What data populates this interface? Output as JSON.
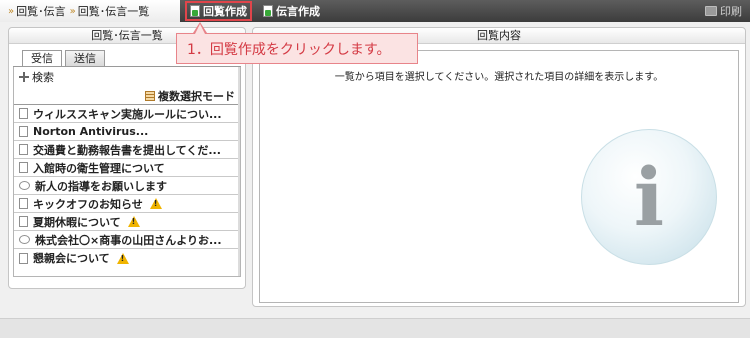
{
  "breadcrumb": {
    "item1": "回覧･伝言",
    "item2": "回覧･伝言一覧"
  },
  "toolbar": {
    "circular_create": "回覧作成",
    "message_create": "伝言作成",
    "print": "印刷"
  },
  "callout": {
    "text": "1．回覧作成をクリックします。"
  },
  "left": {
    "title": "回覧･伝言一覧",
    "tabs": [
      "受信",
      "送信"
    ],
    "search_label": "検索",
    "multi_select_label": "複数選択モード",
    "items": [
      {
        "label": "ウィルススキャン実施ルールについ...",
        "icon": "document-icon",
        "warning": false
      },
      {
        "label": "Norton Antivirus...",
        "icon": "document-icon",
        "warning": false
      },
      {
        "label": "交通費と勤務報告書を提出してくだ...",
        "icon": "document-icon",
        "warning": false
      },
      {
        "label": "入館時の衛生管理について",
        "icon": "document-icon",
        "warning": false
      },
      {
        "label": "新人の指導をお願いします",
        "icon": "speech-bubble-icon",
        "warning": false
      },
      {
        "label": "キックオフのお知らせ",
        "icon": "document-icon",
        "warning": true
      },
      {
        "label": "夏期休暇について",
        "icon": "document-icon",
        "warning": true
      },
      {
        "label": "株式会社〇×商事の山田さんよりお...",
        "icon": "speech-bubble-icon",
        "warning": false
      },
      {
        "label": "懇親会について",
        "icon": "document-icon",
        "warning": true
      }
    ]
  },
  "right": {
    "title": "回覧内容",
    "message": "一覧から項目を選択してください。選択された項目の詳細を表示します。",
    "info_glyph": "i"
  },
  "colors": {
    "callout_text": "#d43a44",
    "callout_border": "#e8848a",
    "toolbar_bg": "#4a4a4a",
    "warning": "#f0b400"
  }
}
